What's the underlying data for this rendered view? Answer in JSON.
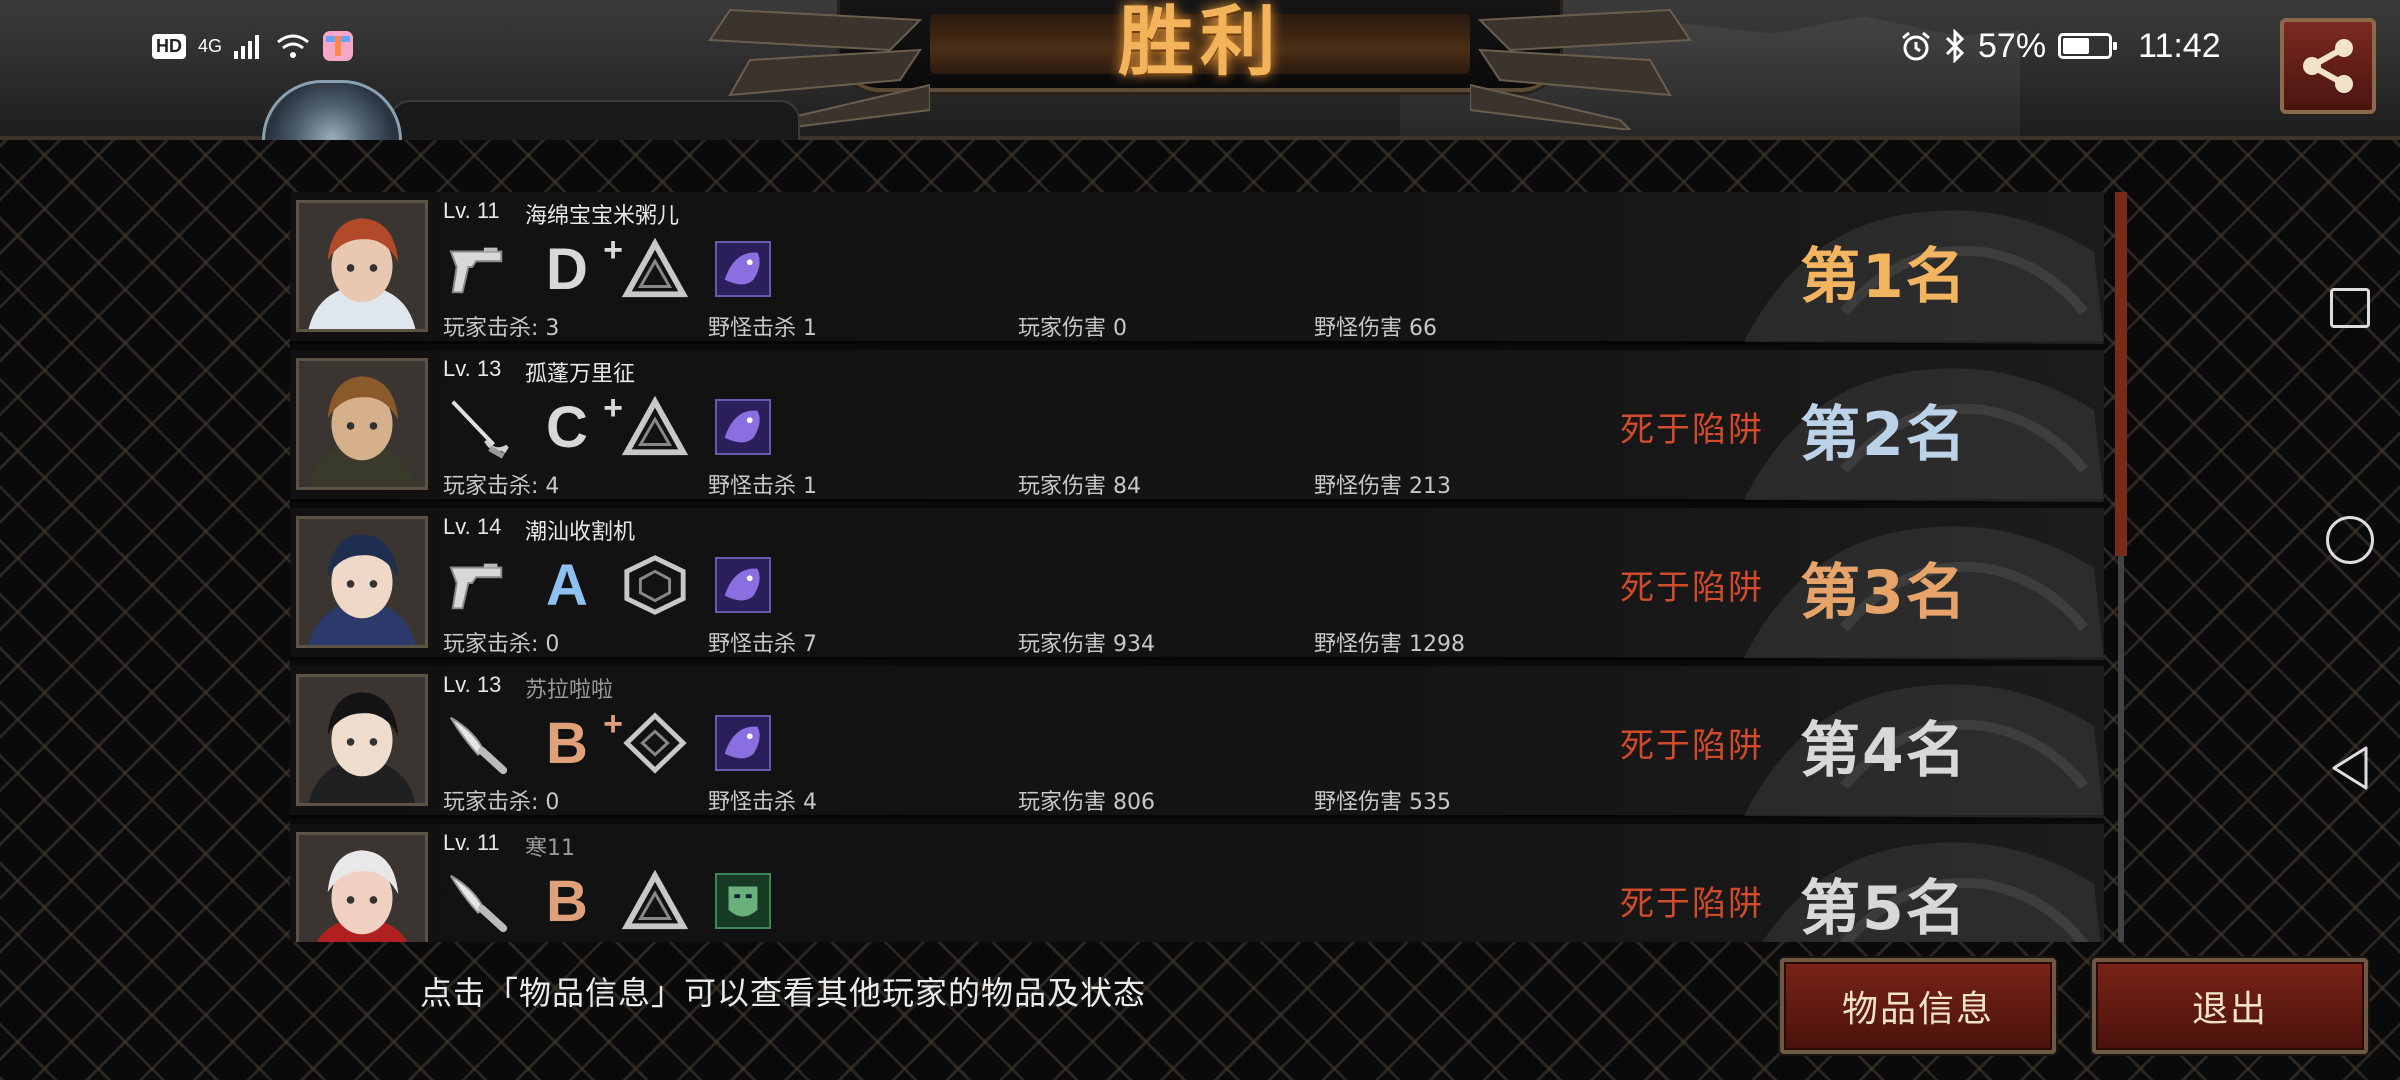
{
  "status_bar": {
    "left_icons": [
      "HD",
      "4G",
      "signal-icon",
      "wifi-icon",
      "app-icon"
    ],
    "hd": "HD",
    "network": "4G",
    "battery_percent": "57%",
    "time": "11:42"
  },
  "header": {
    "title": "胜利",
    "team_label_partial": "海绵宝宝米粥儿"
  },
  "players": [
    {
      "level": "Lv. 11",
      "name": "海绵宝宝米粥儿",
      "weapon": "pistol",
      "grade": "D",
      "grade_plus": "+",
      "emblem": "triangle",
      "item": "purple-beast",
      "kills_player": "玩家击杀: 3",
      "kills_monster": "野怪击杀 1",
      "dmg_player": "玩家伤害 0",
      "dmg_monster": "野怪伤害 66",
      "death": "",
      "rank": "第1名",
      "rank_color": "#f2b45e"
    },
    {
      "level": "Lv. 13",
      "name": "孤蓬万里征",
      "weapon": "rapier",
      "grade": "C",
      "grade_plus": "+",
      "emblem": "triangle",
      "item": "purple-beast",
      "kills_player": "玩家击杀: 4",
      "kills_monster": "野怪击杀 1",
      "dmg_player": "玩家伤害 84",
      "dmg_monster": "野怪伤害 213",
      "death": "死于陷阱",
      "rank": "第2名",
      "rank_color": "#bcd2e8"
    },
    {
      "level": "Lv. 14",
      "name": "潮汕收割机",
      "weapon": "pistol",
      "grade": "A",
      "grade_plus": "",
      "emblem": "cube",
      "item": "purple-beast",
      "kills_player": "玩家击杀: 0",
      "kills_monster": "野怪击杀 7",
      "dmg_player": "玩家伤害 934",
      "dmg_monster": "野怪伤害 1298",
      "death": "死于陷阱",
      "rank": "第3名",
      "rank_color": "#e6a46a"
    },
    {
      "level": "Lv. 13",
      "name": "苏拉啦啦",
      "weapon": "knife",
      "grade": "B",
      "grade_plus": "+",
      "emblem": "diamond",
      "item": "purple-beast",
      "kills_player": "玩家击杀: 0",
      "kills_monster": "野怪击杀 4",
      "dmg_player": "玩家伤害 806",
      "dmg_monster": "野怪伤害 535",
      "death": "死于陷阱",
      "rank": "第4名",
      "rank_color": "#d8d8d8"
    },
    {
      "level": "Lv. 11",
      "name": "寒11",
      "weapon": "knife",
      "grade": "B",
      "grade_plus": "",
      "emblem": "triangle",
      "item": "green-mask",
      "kills_player": "",
      "kills_monster": "",
      "dmg_player": "",
      "dmg_monster": "",
      "death": "死于陷阱",
      "rank": "第5名",
      "rank_color": "#d8d8d8"
    }
  ],
  "footer": {
    "hint": "点击「物品信息」可以查看其他玩家的物品及状态",
    "info_button": "物品信息",
    "exit_button": "退出"
  },
  "colors": {
    "accent": "#f3b35a",
    "button": "#6a1c12",
    "death_text": "#d24a2c"
  }
}
